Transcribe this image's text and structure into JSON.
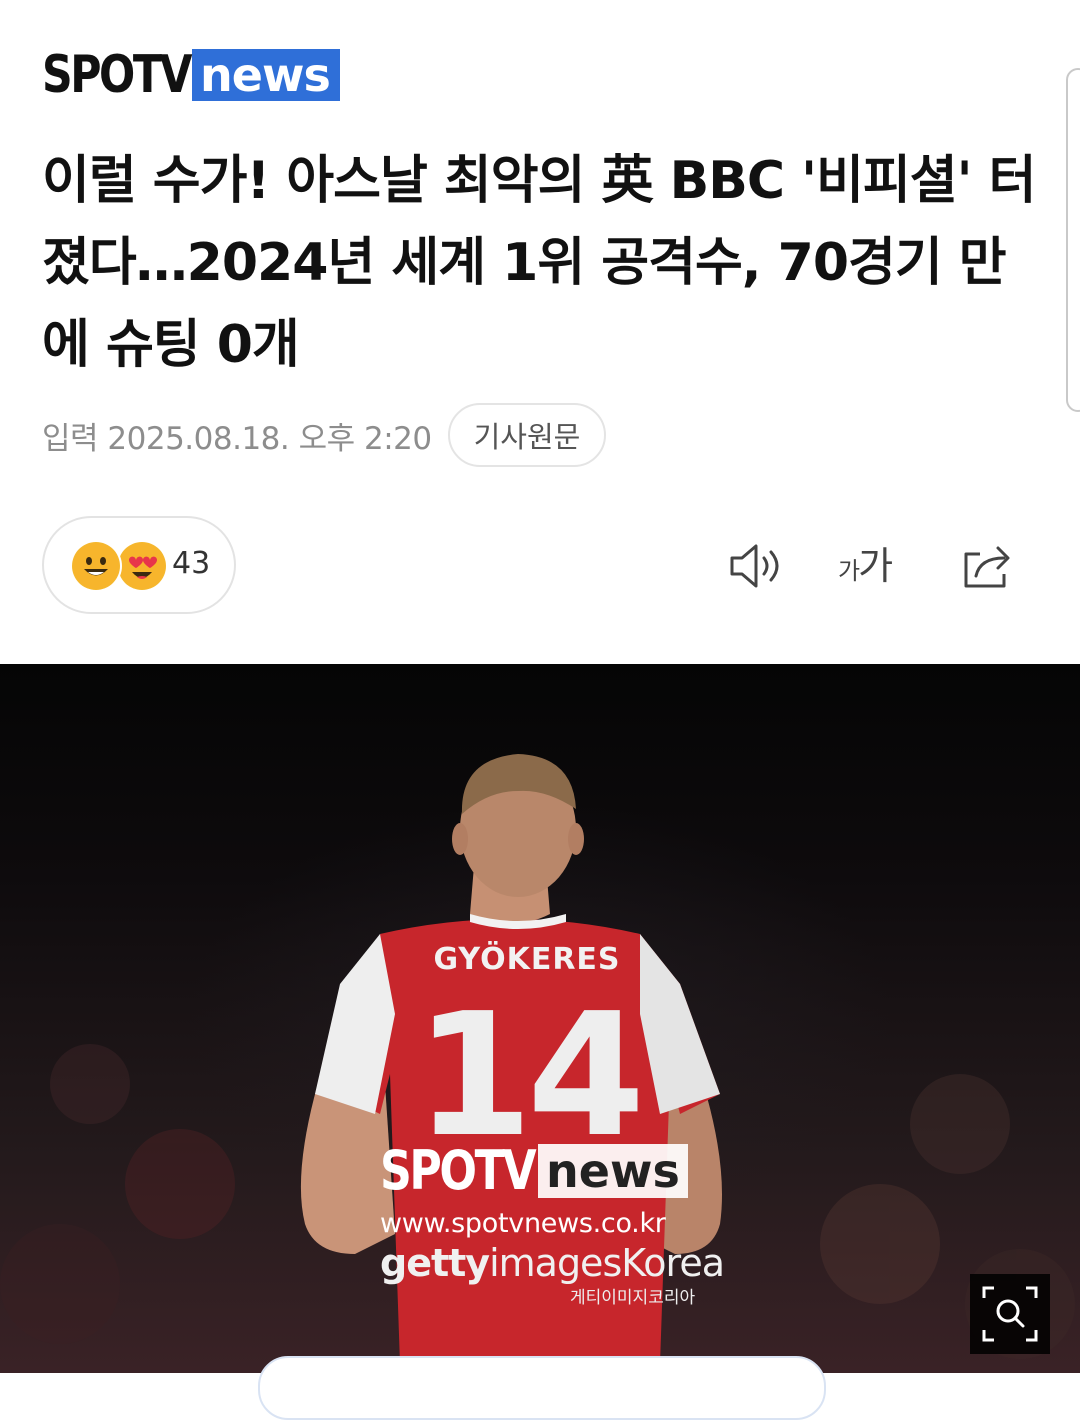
{
  "brand": {
    "logo_main": "SPOTV",
    "logo_sub": "news",
    "accent": "#2f6fd8"
  },
  "article": {
    "headline": "이럴 수가! 아스날 최악의 英 BBC '비피셜' 터졌다…2024년 세계 1위 공격수, 70경기 만에 슈팅 0개",
    "published": "입력 2025.08.18. 오후 2:20",
    "original_link_label": "기사원문"
  },
  "reactions": {
    "count": "43",
    "icons": [
      "grinning-face-icon",
      "heart-eyes-face-icon"
    ]
  },
  "toolbar": {
    "font_small": "가",
    "font_large": "가",
    "icons": [
      "speaker-icon",
      "font-size-icon",
      "share-icon"
    ]
  },
  "photo": {
    "jersey_name": "GYÖKERES",
    "jersey_number": "14",
    "watermark_main": "SPOTV",
    "watermark_sub": "news",
    "watermark_url": "www.spotvnews.co.kr",
    "getty_bold": "getty",
    "getty_light": "images",
    "getty_korea": "Korea",
    "getty_korean": "게티이미지코리아",
    "zoom_icon": "zoom-search-icon"
  }
}
